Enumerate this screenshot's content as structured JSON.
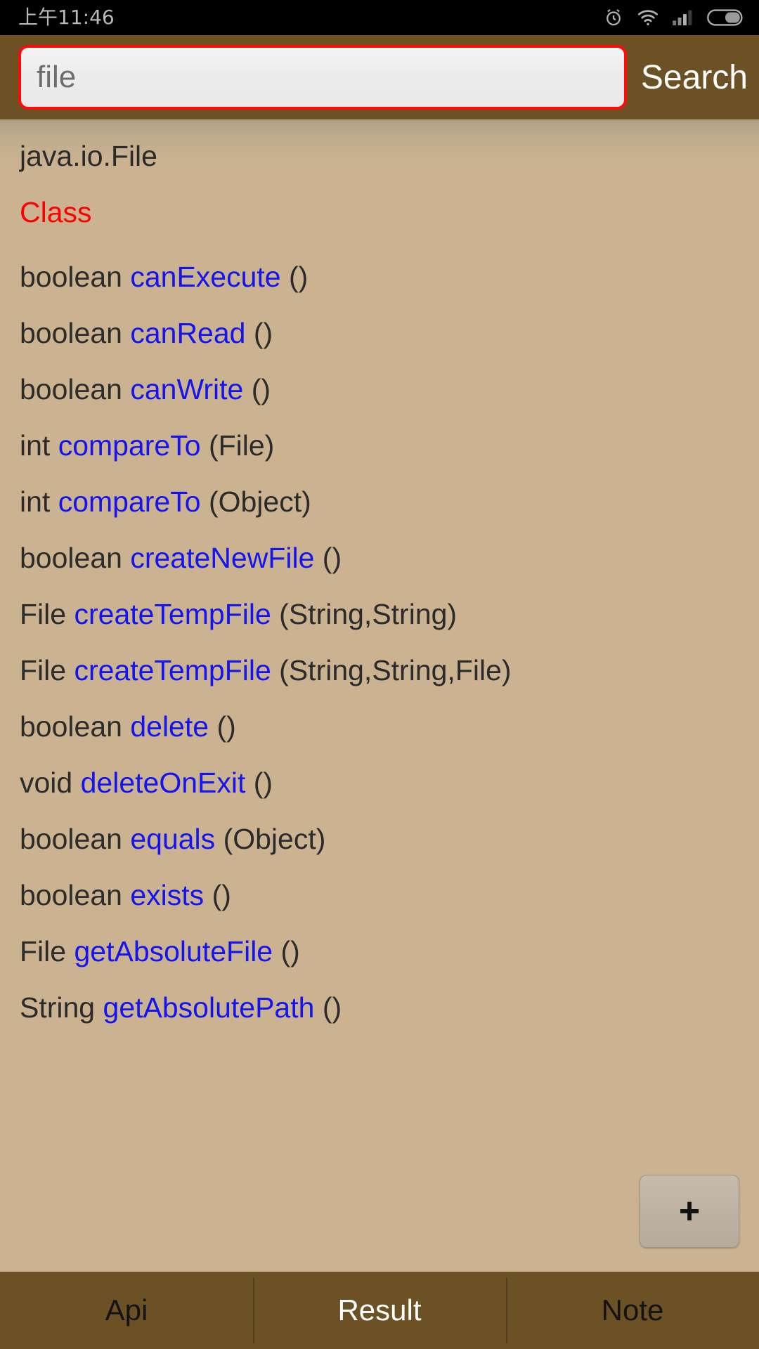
{
  "status_bar": {
    "time": "上午11:46",
    "icons": [
      {
        "name": "alarm-icon"
      },
      {
        "name": "wifi-icon"
      },
      {
        "name": "signal-icon"
      },
      {
        "name": "battery-icon"
      }
    ]
  },
  "header": {
    "search_value": "file",
    "search_placeholder": "file",
    "search_button_label": "Search",
    "bar_color": "#6C5125",
    "input_border_color": "#FF0A0A"
  },
  "content": {
    "background_color": "#CBB391",
    "class_title": "java.io.File",
    "kind_label": "Class",
    "kind_color": "#FF0000",
    "method_name_color": "#1414F0",
    "rows": [
      {
        "rettype": "boolean",
        "method": "canExecute",
        "params": "()"
      },
      {
        "rettype": "boolean",
        "method": "canRead",
        "params": "()"
      },
      {
        "rettype": "boolean",
        "method": "canWrite",
        "params": "()"
      },
      {
        "rettype": "int",
        "method": "compareTo",
        "params": "(File)"
      },
      {
        "rettype": "int",
        "method": "compareTo",
        "params": "(Object)"
      },
      {
        "rettype": "boolean",
        "method": "createNewFile",
        "params": "()"
      },
      {
        "rettype": "File",
        "method": "createTempFile",
        "params": "(String,String)"
      },
      {
        "rettype": "File",
        "method": "createTempFile",
        "params": "(String,String,File)"
      },
      {
        "rettype": "boolean",
        "method": "delete",
        "params": "()"
      },
      {
        "rettype": "void",
        "method": "deleteOnExit",
        "params": "()"
      },
      {
        "rettype": "boolean",
        "method": "equals",
        "params": "(Object)"
      },
      {
        "rettype": "boolean",
        "method": "exists",
        "params": "()"
      },
      {
        "rettype": "File",
        "method": "getAbsoluteFile",
        "params": "()"
      },
      {
        "rettype": "String",
        "method": "getAbsolutePath",
        "params": "()"
      }
    ]
  },
  "fab": {
    "label": "+"
  },
  "tabbar": {
    "background_color": "#6C5125",
    "tabs": [
      {
        "label": "Api",
        "selected": false
      },
      {
        "label": "Result",
        "selected": true
      },
      {
        "label": "Note",
        "selected": false
      }
    ]
  }
}
